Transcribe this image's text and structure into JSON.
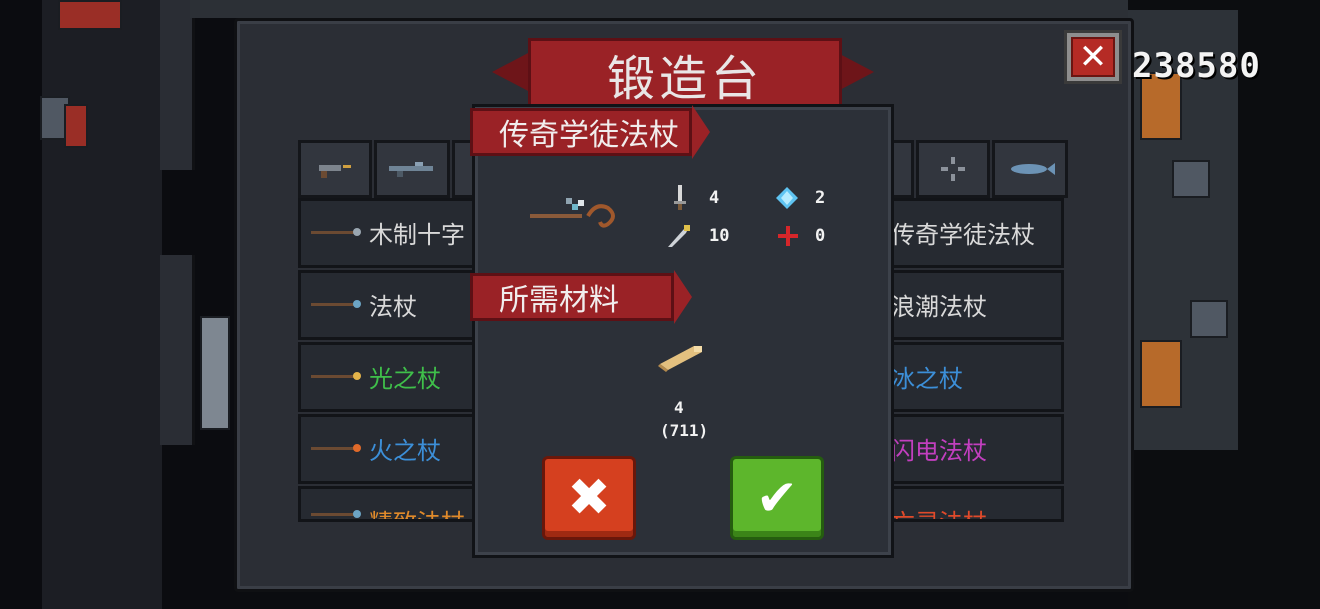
{
  "score": "238580",
  "forge": {
    "title": "锻造台",
    "close_label": "✕"
  },
  "weapon_list": {
    "left": [
      {
        "label": "木制十字",
        "color": "#d9d9d9",
        "tip": "#9aa6b0"
      },
      {
        "label": "法杖",
        "color": "#d9d9d9",
        "tip": "#6ca4c4"
      },
      {
        "label": "光之杖",
        "color": "#3fbf4a",
        "tip": "#e3b34a"
      },
      {
        "label": "火之杖",
        "color": "#3c8fd8",
        "tip": "#e06a2a"
      },
      {
        "label": "精致法杖",
        "color": "#e08a2a",
        "tip": "#6ca4c4"
      }
    ],
    "right": [
      {
        "label": "传奇学徒法杖",
        "color": "#d9d9d9"
      },
      {
        "label": "浪潮法杖",
        "color": "#d9d9d9"
      },
      {
        "label": "冰之杖",
        "color": "#3c8fd8"
      },
      {
        "label": "闪电法杖",
        "color": "#c23fbf"
      },
      {
        "label": "亡灵法杖",
        "color": "#e04a2a"
      }
    ]
  },
  "detail": {
    "weapon_name": "传奇学徒法杖",
    "stats": {
      "attack": "4",
      "energy": "2",
      "crit": "10",
      "accuracy": "0"
    },
    "materials_heading": "所需材料",
    "material_required": "4",
    "material_owned": "(711)"
  },
  "buttons": {
    "cancel": "✖",
    "confirm": "✔"
  }
}
